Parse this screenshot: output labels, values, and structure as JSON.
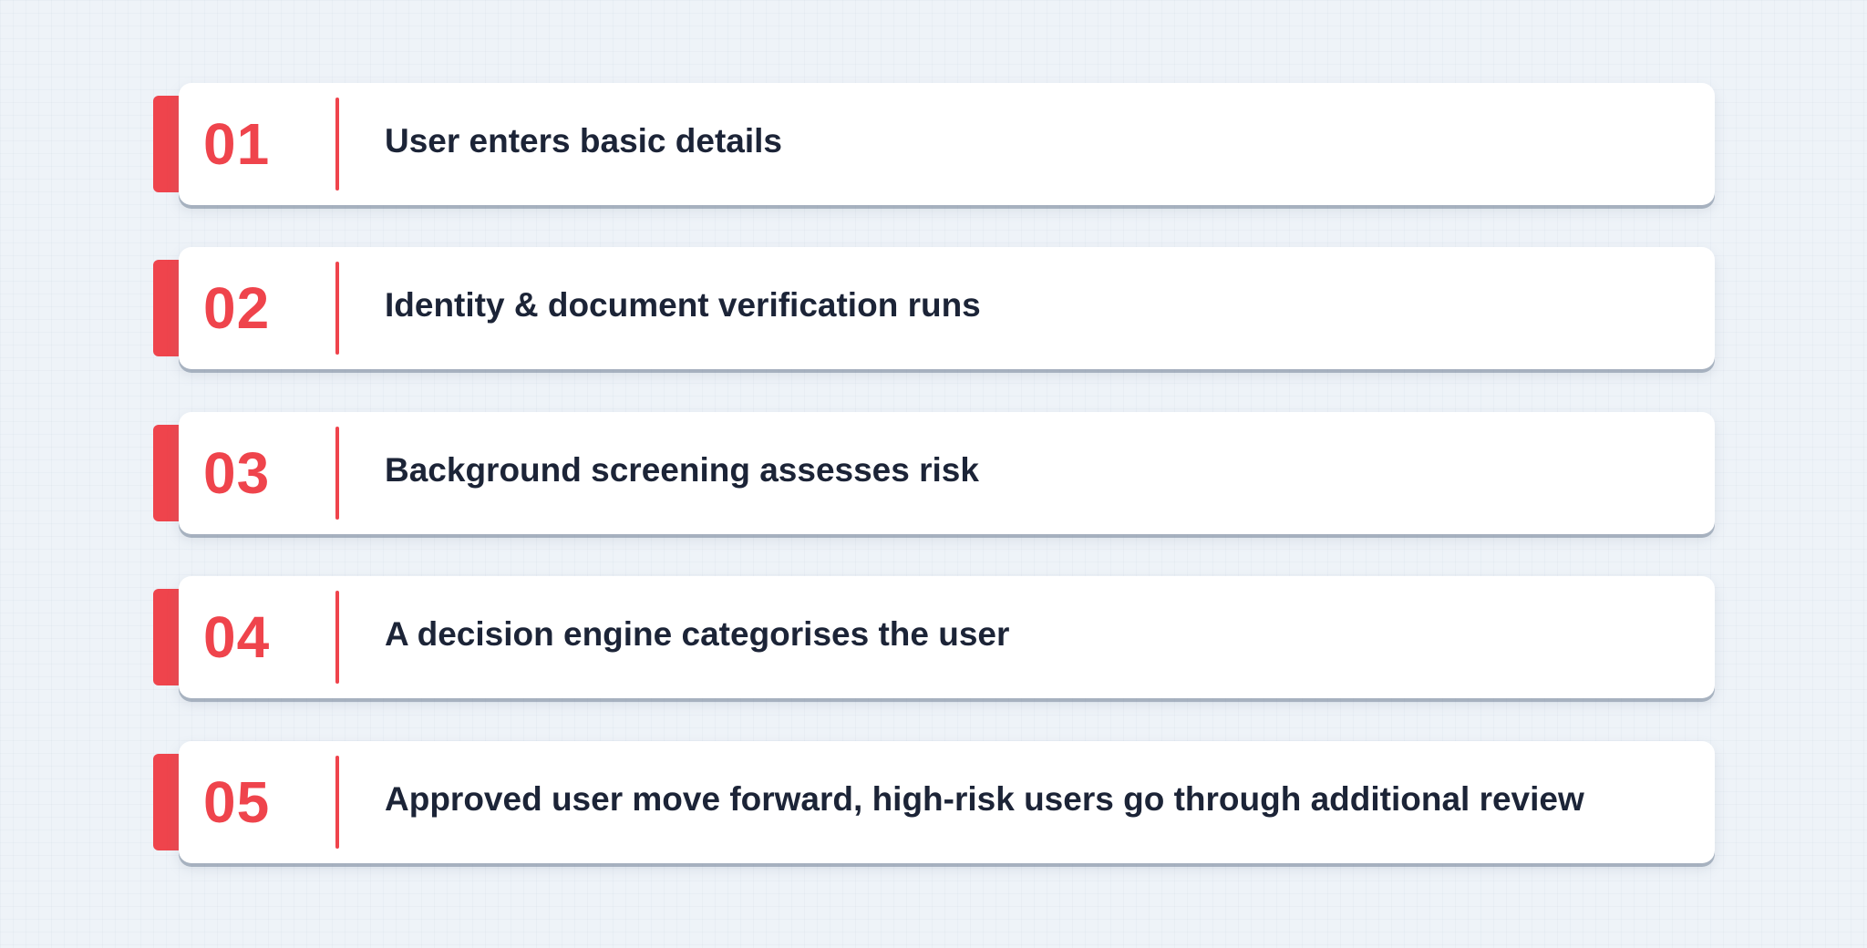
{
  "theme": {
    "accent": "#ef444c",
    "text": "#1c2437",
    "card": "#ffffff",
    "background": "#eef3f8"
  },
  "steps": [
    {
      "number": "01",
      "text": "User enters basic details"
    },
    {
      "number": "02",
      "text": "Identity & document verification runs"
    },
    {
      "number": "03",
      "text": "Background screening assesses risk"
    },
    {
      "number": "04",
      "text": "A decision engine categorises the user"
    },
    {
      "number": "05",
      "text": "Approved user move forward, high-risk users go through additional review"
    }
  ]
}
